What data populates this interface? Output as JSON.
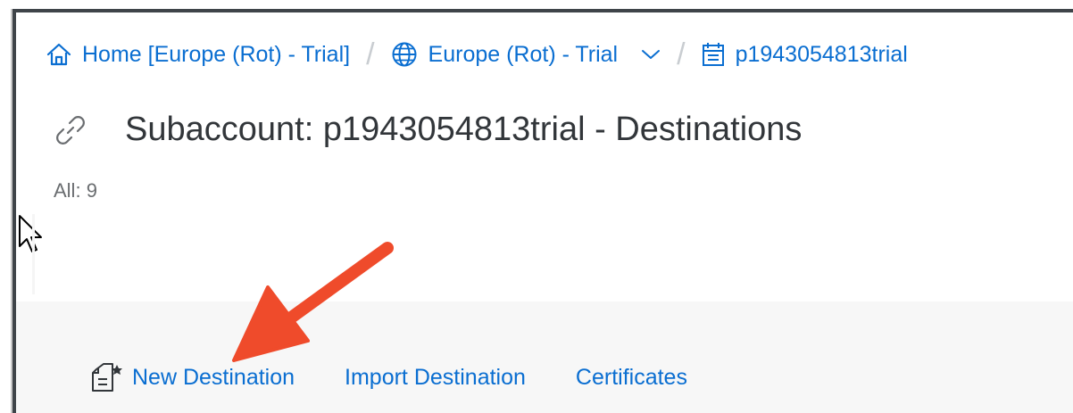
{
  "breadcrumb": {
    "home_label": "Home [Europe (Rot) - Trial]",
    "region_label": "Europe (Rot) - Trial",
    "subaccount_label": "p1943054813trial",
    "separator": "/"
  },
  "header": {
    "title": "Subaccount: p1943054813trial - Destinations",
    "count_prefix": "All:",
    "count_value": "9"
  },
  "toolbar": {
    "new_destination_label": "New Destination",
    "import_destination_label": "Import Destination",
    "certificates_label": "Certificates"
  },
  "icons": {
    "home": "home-icon",
    "region": "globe-icon",
    "region_dropdown": "chevron-down-icon",
    "subaccount": "calendar-list-icon",
    "title": "link-icon",
    "new_destination": "new-document-icon",
    "pointer": "mouse-cursor-icon",
    "annotation": "red-arrow-annotation"
  },
  "colors": {
    "link": "#0a6ed1",
    "title": "#32363a",
    "muted": "#6a6d70",
    "toolbar_bg": "#f7f7f7",
    "window_border": "#3f4449",
    "annotation_arrow": "#ef4b2b"
  }
}
